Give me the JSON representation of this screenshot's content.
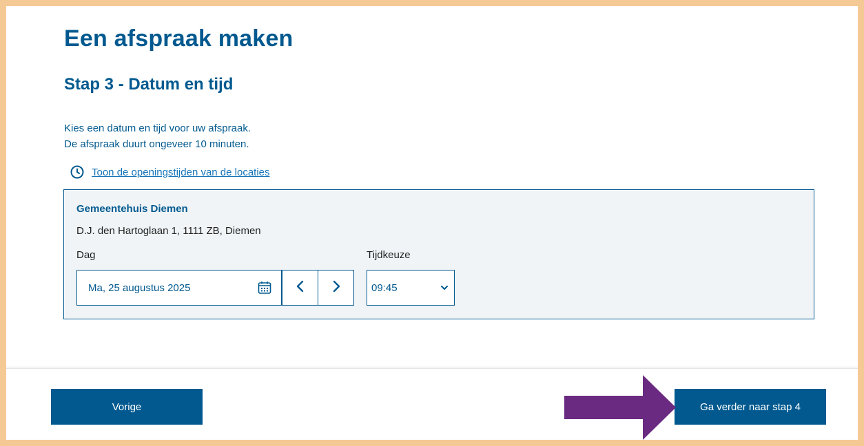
{
  "page": {
    "title": "Een afspraak maken",
    "step_title": "Stap 3 - Datum en tijd",
    "intro_line1": "Kies een datum en tijd voor uw afspraak.",
    "intro_line2": "De afspraak duurt ongeveer 10 minuten.",
    "hours_link": "Toon de openingstijden van de locaties"
  },
  "location": {
    "name": "Gemeentehuis Diemen",
    "address": "D.J. den Hartoglaan 1, 1111 ZB, Diemen",
    "day_label": "Dag",
    "date_value": "Ma, 25 augustus 2025",
    "time_label": "Tijdkeuze",
    "time_value": "09:45"
  },
  "footer": {
    "prev_label": "Vorige",
    "next_label": "Ga verder naar stap 4"
  },
  "icons": {
    "hours": "clock-icon",
    "date": "calendar-icon",
    "prev_day": "chevron-left-icon",
    "next_day": "chevron-right-icon",
    "time_dropdown": "chevron-down-icon",
    "annotation": "arrow-right-icon"
  },
  "colors": {
    "brand_blue": "#01598f",
    "link_blue": "#1573b8",
    "panel_bg": "#f0f4f7",
    "frame_border": "#f5c994",
    "annotation_arrow": "#6b2a82"
  }
}
